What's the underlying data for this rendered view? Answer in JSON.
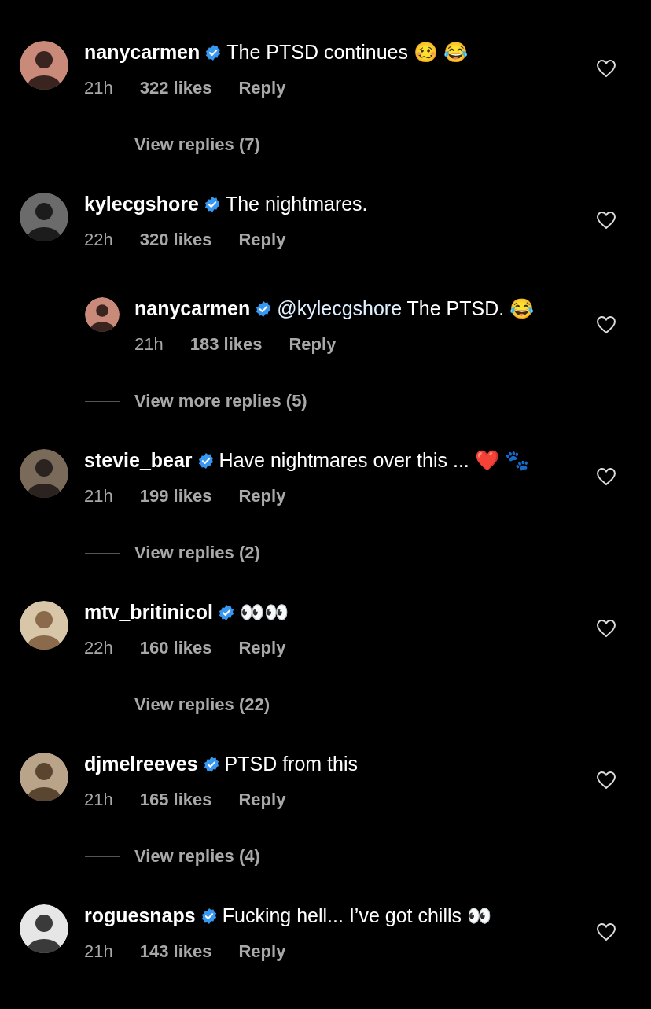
{
  "comments": [
    {
      "username": "nanycarmen",
      "verified": true,
      "text": "The PTSD continues 🥴 😂",
      "time": "21h",
      "likes": "322 likes",
      "reply_label": "Reply",
      "view_replies": "View replies (7)"
    },
    {
      "username": "kylecgshore",
      "verified": true,
      "text": "The nightmares.",
      "time": "22h",
      "likes": "320 likes",
      "reply_label": "Reply",
      "replies": [
        {
          "username": "nanycarmen",
          "verified": true,
          "mention": "@kylecgshore",
          "text": "The PTSD. 😂",
          "time": "21h",
          "likes": "183 likes",
          "reply_label": "Reply"
        }
      ],
      "view_replies": "View more replies (5)"
    },
    {
      "username": "stevie_bear",
      "verified": true,
      "text": "Have nightmares over this ... ❤️ 🐾",
      "time": "21h",
      "likes": "199 likes",
      "reply_label": "Reply",
      "view_replies": "View replies (2)"
    },
    {
      "username": "mtv_britinicol",
      "verified": true,
      "text": "👀👀",
      "time": "22h",
      "likes": "160 likes",
      "reply_label": "Reply",
      "view_replies": "View replies (22)"
    },
    {
      "username": "djmelreeves",
      "verified": true,
      "text": "PTSD from this",
      "time": "21h",
      "likes": "165 likes",
      "reply_label": "Reply",
      "view_replies": "View replies (4)"
    },
    {
      "username": "roguesnaps",
      "verified": true,
      "text": "Fucking hell... I’ve got chills 👀",
      "time": "21h",
      "likes": "143 likes",
      "reply_label": "Reply"
    }
  ]
}
